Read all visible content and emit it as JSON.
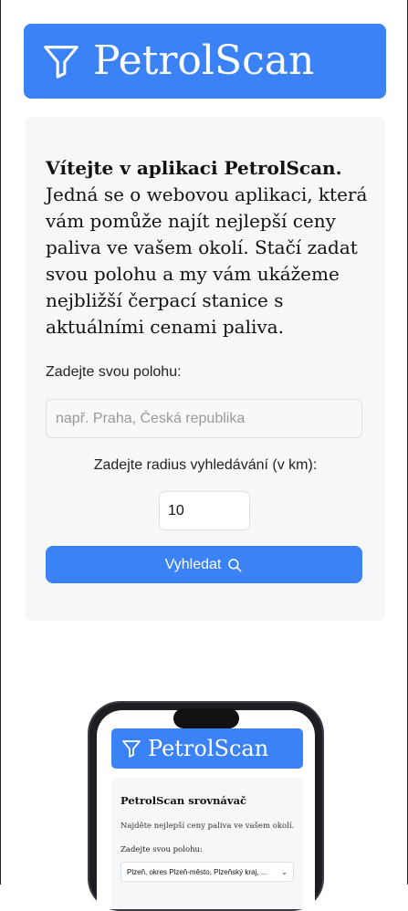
{
  "header": {
    "app_title": "PetrolScan",
    "icon": "filter-icon",
    "accent_color": "#3b82f6"
  },
  "intro": {
    "bold_text": "Vítejte v aplikaci PetrolScan.",
    "body_text": " Jedná se o webovou aplikaci, která vám pomůže najít nejlepší ceny paliva ve vašem okolí. Stačí zadat svou polohu a my vám ukážeme nejbližší čerpací stanice s aktuálními cenami paliva."
  },
  "form": {
    "location_label": "Zadejte svou polohu:",
    "location_placeholder": "např. Praha, Česká republika",
    "location_value": "",
    "radius_label": "Zadejte radius vyhledávání (v km):",
    "radius_value": "10",
    "search_button_label": "Vyhledat",
    "search_icon": "search-icon"
  },
  "phone_preview": {
    "app_title": "PetrolScan",
    "heading": "PetrolScan srovnávač",
    "subtitle": "Najděte nejlepší ceny paliva ve vašem okolí.",
    "location_label": "Zadejte svou polohu:",
    "location_value": "Plzeň, okres Plzeň-město, Plzeňský kraj, ..."
  }
}
